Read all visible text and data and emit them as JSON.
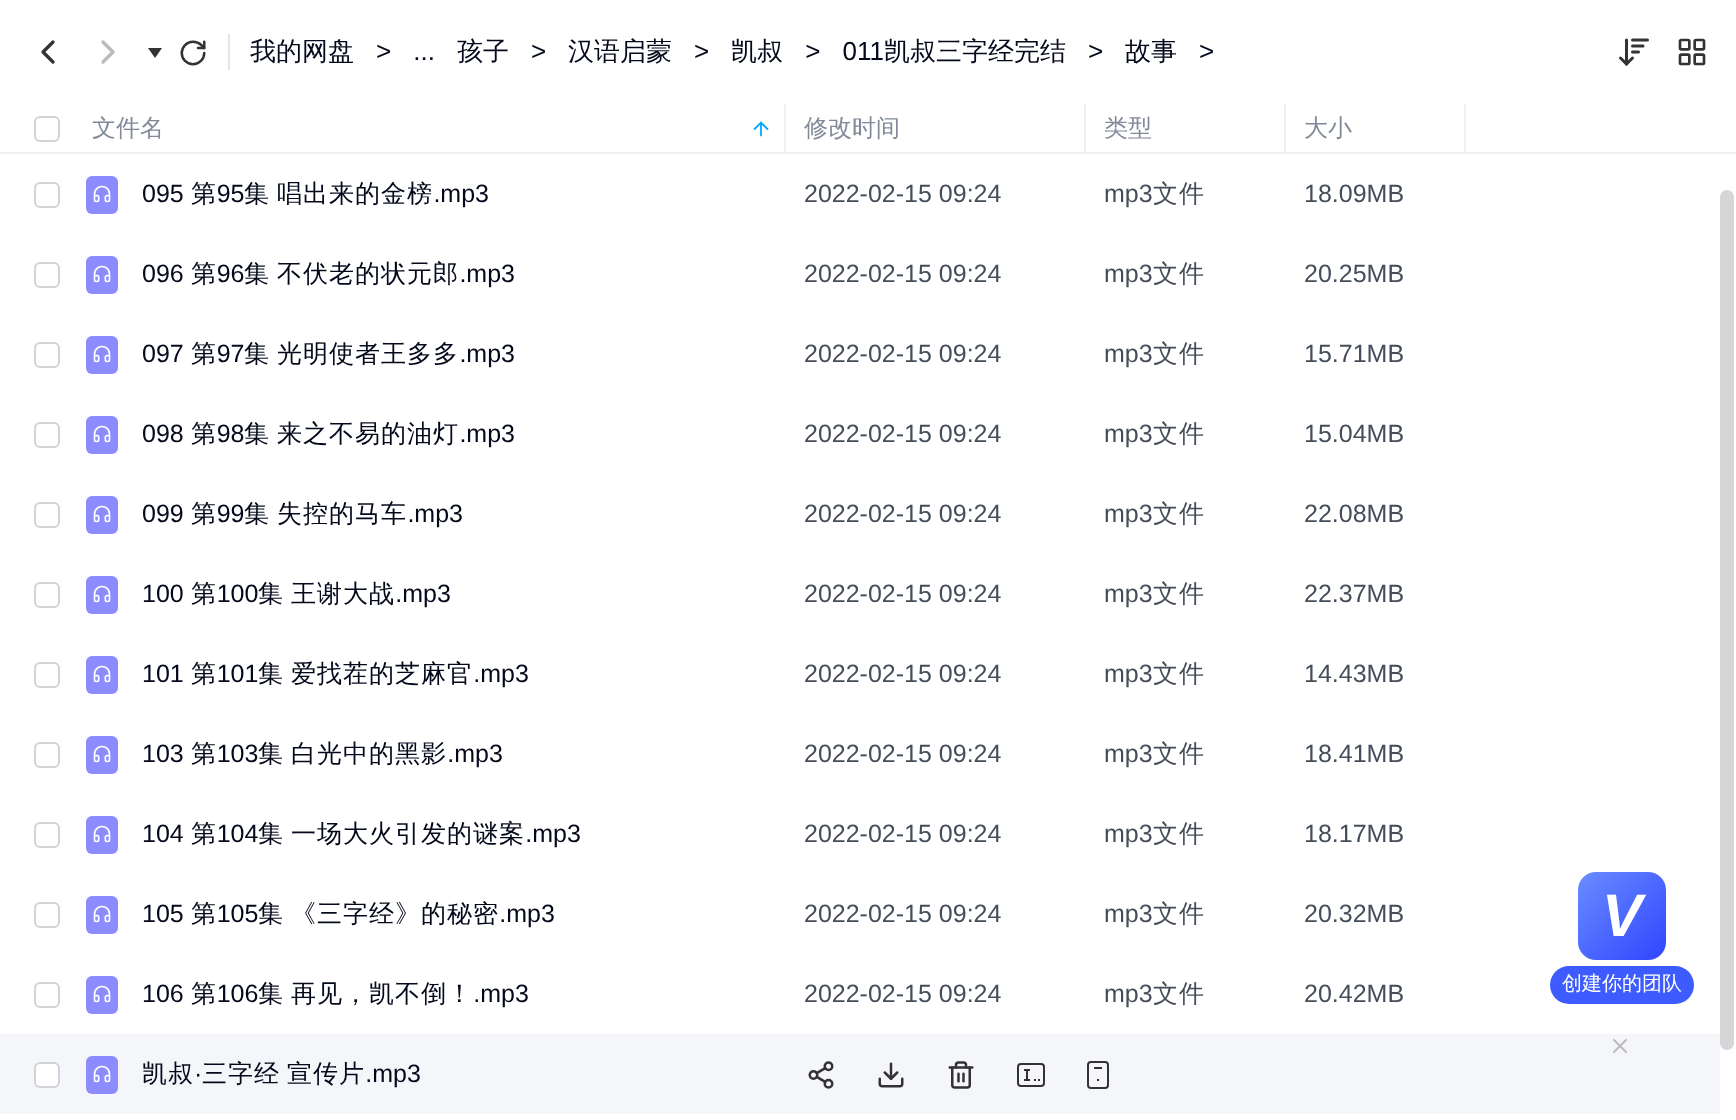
{
  "toolbar": {
    "breadcrumbs": [
      "我的网盘",
      ">",
      "...",
      "孩子",
      ">",
      "汉语启蒙",
      ">",
      "凯叔",
      ">",
      "011凯叔三字经完结",
      ">",
      "故事",
      ">"
    ]
  },
  "select_all": {
    "checked": false
  },
  "columns": [
    {
      "label": "文件名",
      "sorted": true
    },
    {
      "label": "修改时间",
      "sorted": false
    },
    {
      "label": "类型",
      "sorted": false
    },
    {
      "label": "大小",
      "sorted": false
    }
  ],
  "rows": [
    {
      "name": "095 第95集 唱出来的金榜.mp3",
      "modified": "2022-02-15 09:24",
      "type": "mp3文件",
      "size": "18.09MB",
      "checked": false,
      "hovered": false
    },
    {
      "name": "096 第96集 不伏老的状元郎.mp3",
      "modified": "2022-02-15 09:24",
      "type": "mp3文件",
      "size": "20.25MB",
      "checked": false,
      "hovered": false
    },
    {
      "name": "097 第97集 光明使者王多多.mp3",
      "modified": "2022-02-15 09:24",
      "type": "mp3文件",
      "size": "15.71MB",
      "checked": false,
      "hovered": false
    },
    {
      "name": "098 第98集 来之不易的油灯.mp3",
      "modified": "2022-02-15 09:24",
      "type": "mp3文件",
      "size": "15.04MB",
      "checked": false,
      "hovered": false
    },
    {
      "name": "099 第99集 失控的马车.mp3",
      "modified": "2022-02-15 09:24",
      "type": "mp3文件",
      "size": "22.08MB",
      "checked": false,
      "hovered": false
    },
    {
      "name": "100 第100集 王谢大战.mp3",
      "modified": "2022-02-15 09:24",
      "type": "mp3文件",
      "size": "22.37MB",
      "checked": false,
      "hovered": false
    },
    {
      "name": "101 第101集 爱找茬的芝麻官.mp3",
      "modified": "2022-02-15 09:24",
      "type": "mp3文件",
      "size": "14.43MB",
      "checked": false,
      "hovered": false
    },
    {
      "name": "103 第103集 白光中的黑影.mp3",
      "modified": "2022-02-15 09:24",
      "type": "mp3文件",
      "size": "18.41MB",
      "checked": false,
      "hovered": false
    },
    {
      "name": "104 第104集 一场大火引发的谜案.mp3",
      "modified": "2022-02-15 09:24",
      "type": "mp3文件",
      "size": "18.17MB",
      "checked": false,
      "hovered": false
    },
    {
      "name": "105 第105集 《三字经》的秘密.mp3",
      "modified": "2022-02-15 09:24",
      "type": "mp3文件",
      "size": "20.32MB",
      "checked": false,
      "hovered": false
    },
    {
      "name": "106 第106集 再见，凯不倒！.mp3",
      "modified": "2022-02-15 09:24",
      "type": "mp3文件",
      "size": "20.42MB",
      "checked": false,
      "hovered": false
    },
    {
      "name": "凯叔·三字经 宣传片.mp3",
      "checked": false,
      "hovered": true
    }
  ],
  "promo": {
    "logo_letter": "V",
    "label": "创建你的团队"
  }
}
